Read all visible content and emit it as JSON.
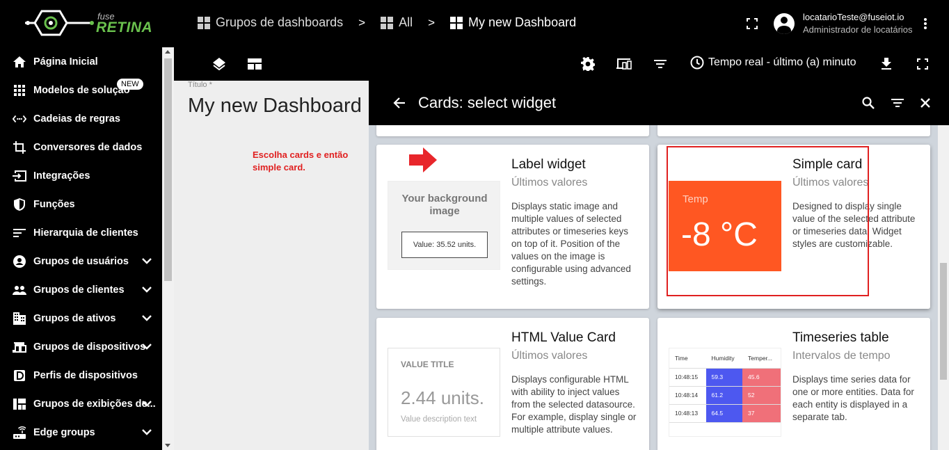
{
  "header": {
    "logo_fuse": "fuse",
    "logo_retina": "RETINA",
    "breadcrumbs": [
      {
        "label": "Grupos de dashboards"
      },
      {
        "label": "All"
      },
      {
        "label": "My new Dashboard"
      }
    ],
    "breadcrumb_separator": ">",
    "user_email": "locatarioTeste@fuseiot.io",
    "user_role": "Administrador de locatários"
  },
  "sidebar": {
    "items": [
      {
        "label": "Página Inicial",
        "icon": "home-icon"
      },
      {
        "label": "Modelos de solução",
        "icon": "apps-icon",
        "badge": "NEW"
      },
      {
        "label": "Cadeias de regras",
        "icon": "rule-chain-icon"
      },
      {
        "label": "Conversores de dados",
        "icon": "crop-icon"
      },
      {
        "label": "Integrações",
        "icon": "input-icon"
      },
      {
        "label": "Funções",
        "icon": "shield-icon"
      },
      {
        "label": "Hierarquia de clientes",
        "icon": "sort-icon"
      },
      {
        "label": "Grupos de usuários",
        "icon": "account-circle-icon",
        "expandable": true
      },
      {
        "label": "Grupos de clientes",
        "icon": "people-icon",
        "expandable": true
      },
      {
        "label": "Grupos de ativos",
        "icon": "domain-icon",
        "expandable": true
      },
      {
        "label": "Grupos de dispositivos",
        "icon": "devices-icon",
        "expandable": true
      },
      {
        "label": "Perfis de dispositivos",
        "icon": "device-profile-icon"
      },
      {
        "label": "Grupos de exibições de...",
        "icon": "view-quilt-icon",
        "expandable": true
      },
      {
        "label": "Edge groups",
        "icon": "router-icon",
        "expandable": true
      }
    ]
  },
  "toolbar": {
    "timewindow": "Tempo real - último (a) minuto"
  },
  "canvas": {
    "title_label": "Título *",
    "title_value": "My new Dashboard",
    "annotation": "Escolha cards e então simple card."
  },
  "panel": {
    "title": "Cards: select widget",
    "cards": [
      {
        "name": "Label widget",
        "type": "Últimos valores",
        "description": "Displays static image and multiple values of selected attributes or timeseries keys on top of it. Position of the values on the image is configurable using advanced settings.",
        "preview_bg_text": "Your background image",
        "preview_value": "Value: 35.52 units."
      },
      {
        "name": "Simple card",
        "type": "Últimos valores",
        "description": "Designed to display single value of the selected attribute or timeseries data. Widget styles are customizable.",
        "preview_label": "Temp",
        "preview_value": "-8 °C"
      },
      {
        "name": "HTML Value Card",
        "type": "Últimos valores",
        "description": "Displays configurable HTML with ability to inject values from the selected datasource. For example, display single or multiple attribute values.",
        "preview_title": "VALUE TITLE",
        "preview_value": "2.44 units.",
        "preview_desc": "Value description text"
      },
      {
        "name": "Timeseries table",
        "type": "Intervalos de tempo",
        "description": "Displays time series data for one or more entities. Data for each entity is displayed in a separate tab.",
        "preview_headers": [
          "Time",
          "Humidity",
          "Temper..."
        ],
        "preview_rows": [
          [
            "10:48:15",
            "59.3",
            "45.6"
          ],
          [
            "10:48:14",
            "61.2",
            "52"
          ],
          [
            "10:48:13",
            "64.5",
            "37"
          ]
        ]
      }
    ]
  },
  "colors": {
    "brand_green": "#6ac14d",
    "simple_card_bg": "#ff5722",
    "annotation_red": "#e02020",
    "humidity_cell": "#4d58f0",
    "temperature_cell": "#f07079"
  }
}
